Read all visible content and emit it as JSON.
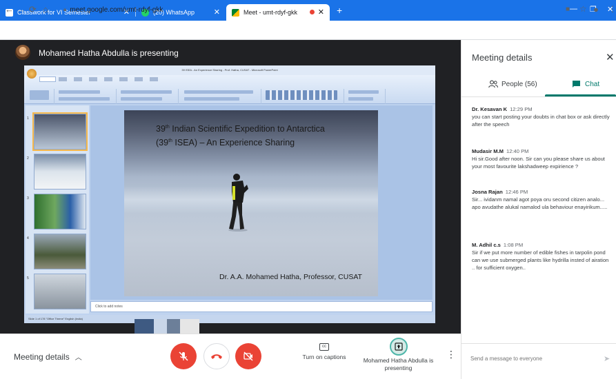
{
  "browser": {
    "tabs": [
      {
        "title": "Classwork for VI Semester",
        "favicon_color": "#1a73e8",
        "active": false
      },
      {
        "title": "(20) WhatsApp",
        "favicon_color": "#25d366",
        "active": false
      },
      {
        "title": "Meet - umt-rdyf-gkk",
        "favicon_color": "#00832d",
        "active": true
      }
    ],
    "new_tab": "+",
    "url": "meet.google.com/umt-rdyf-gkk",
    "recording_dot_color": "#ea4335"
  },
  "presenter": {
    "title": "Mohamed Hatha Abdulla is presenting"
  },
  "ppt": {
    "window_title": "39 ISEA - An Experience Sharing - Prof. Hatha, CUSAT - Microsoft PowerPoint",
    "notes_placeholder": "Click to add notes",
    "status": "Slide 1 of 178    \"Office Theme\"    English (India)",
    "slide": {
      "title_line1_pre": "39",
      "title_line1_sup": "th",
      "title_line1_post": " Indian Scientific Expedition to Antarctica",
      "title_line2_pre": "(39",
      "title_line2_sup": "th",
      "title_line2_post": " ISEA) – An Experience Sharing",
      "credit": "Dr. A.A. Mohamed Hatha, Professor, CUSAT"
    }
  },
  "panel": {
    "title": "Meeting details",
    "people_label": "People (56)",
    "chat_label": "Chat",
    "accent": "#00796b",
    "messages": [
      {
        "sender": "Dr. Kesavan K",
        "time": "12:29 PM",
        "text": "you can start posting your doubts in chat box or ask directly after the speech"
      },
      {
        "sender": "Mudasir M.M",
        "time": "12:40 PM",
        "text": "Hi sir.Good after noon. Sir can you please share us about your most favourite lakshadweep expirience ?"
      },
      {
        "sender": "Josna Rajan",
        "time": "12:46 PM",
        "text": "Sir... ividanm namal agot poya oru second citizen analo... apo avudathe alukal namalod ula behaviour enayirikum....."
      },
      {
        "sender": "M. Adhil c.s",
        "time": "1:08 PM",
        "text": "Sir if we put more number of edible fishes in tarpolin pond can we use submerged plants like hydrilla insted of airation .. for sufficient oxygen.."
      }
    ],
    "input_placeholder": "Send a message to everyone"
  },
  "controls": {
    "details_label": "Meeting details",
    "captions_label": "Turn on captions",
    "presenting_label": "Mohamed Hatha Abdulla is presenting",
    "red": "#ea4335"
  }
}
